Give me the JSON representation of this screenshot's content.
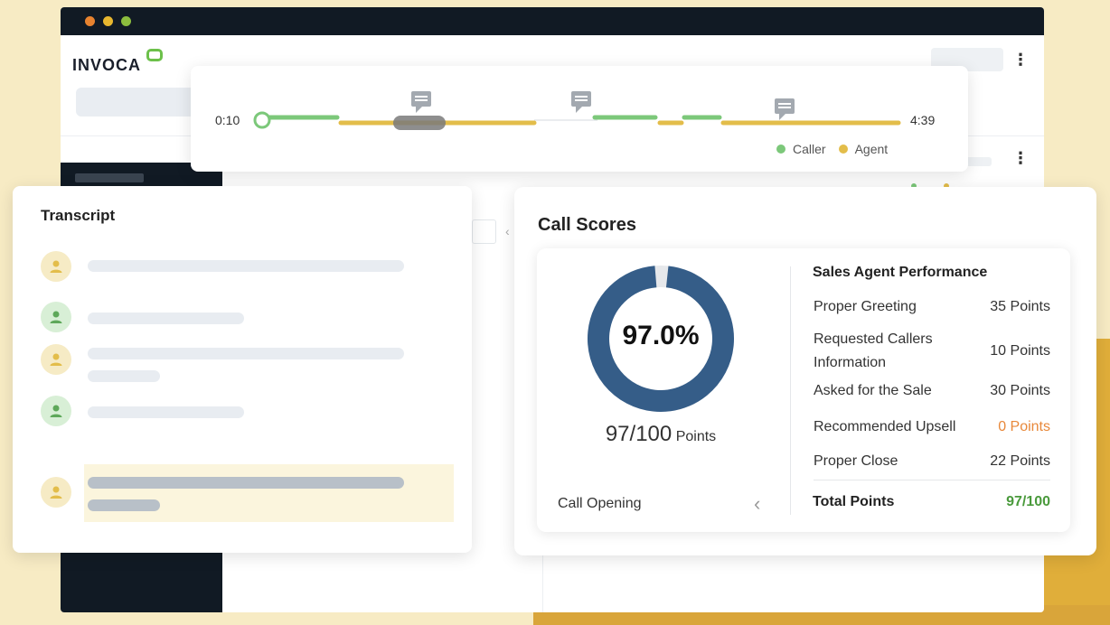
{
  "colors": {
    "caller": "#7cc87a",
    "agent": "#e3bd4a",
    "donut": "#355d88",
    "window_dark": "#111a24",
    "background": "#f7ebc4",
    "accent_gold": "#e0ae3a",
    "orange": "#e8883a",
    "green_total": "#4a9a3c"
  },
  "header": {
    "logo_text": "INVOCA"
  },
  "timeline": {
    "start_time": "0:10",
    "end_time": "4:39",
    "legend": [
      {
        "label": "Caller",
        "color": "#7cc87a"
      },
      {
        "label": "Agent",
        "color": "#e3bd4a"
      }
    ],
    "comment_icons": [
      "comment-icon",
      "comment-icon",
      "comment-icon"
    ]
  },
  "transcript": {
    "title": "Transcript",
    "speakers": [
      "agent",
      "caller",
      "agent",
      "caller",
      "agent"
    ]
  },
  "call_scores": {
    "title": "Call Scores",
    "score_percent": 97.0,
    "score_label": "97.0%",
    "points_value": "97/100",
    "points_unit": "Points",
    "section_selector": "Call Opening",
    "performance": {
      "title": "Sales Agent Performance",
      "rows": [
        {
          "name": "Proper Greeting",
          "points": "35 Points"
        },
        {
          "name": "Requested Callers Information",
          "points": "10 Points"
        },
        {
          "name": "Asked for the Sale",
          "points": "30 Points"
        },
        {
          "name": "Recommended Upsell",
          "points": "0 Points"
        },
        {
          "name": "Proper Close",
          "points": "22 Points"
        }
      ],
      "total_label": "Total Points",
      "total_value": "97/100"
    }
  }
}
